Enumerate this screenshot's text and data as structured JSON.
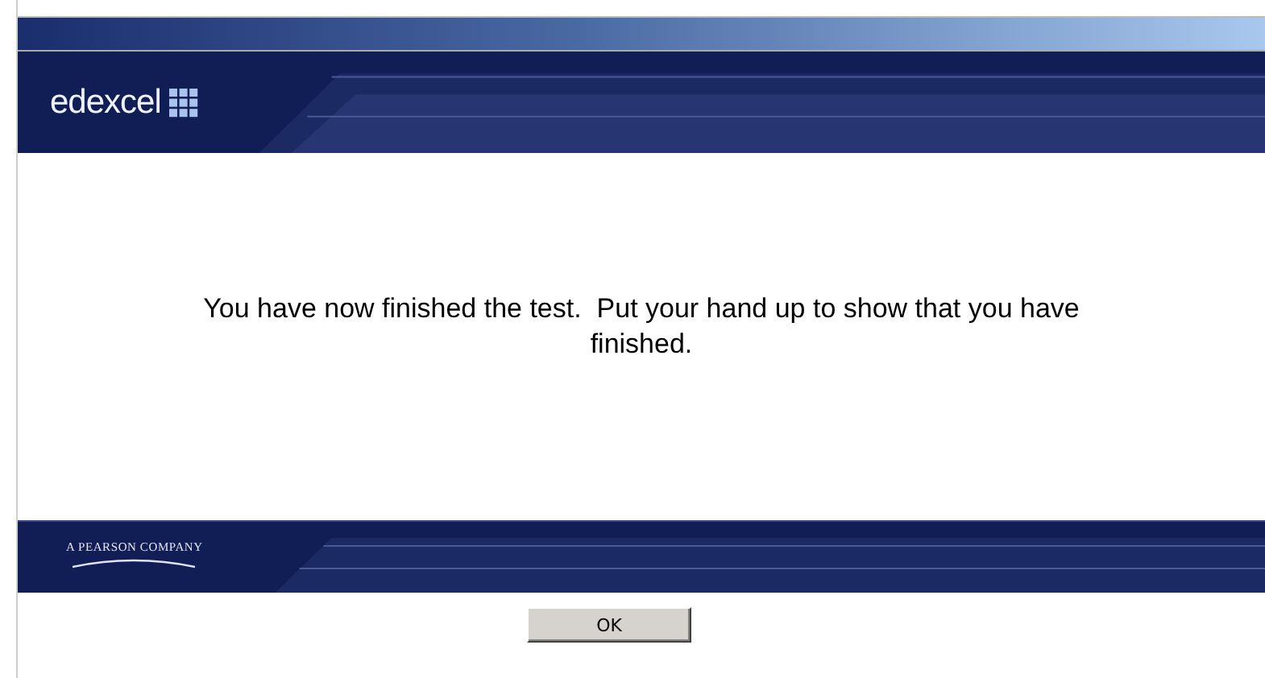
{
  "header": {
    "logo_text": "edexcel"
  },
  "message": "You have now finished the test.  Put your hand up to show that you have finished.",
  "footer": {
    "tagline": "A PEARSON COMPANY"
  },
  "buttons": [
    {
      "label": "OK"
    }
  ]
}
